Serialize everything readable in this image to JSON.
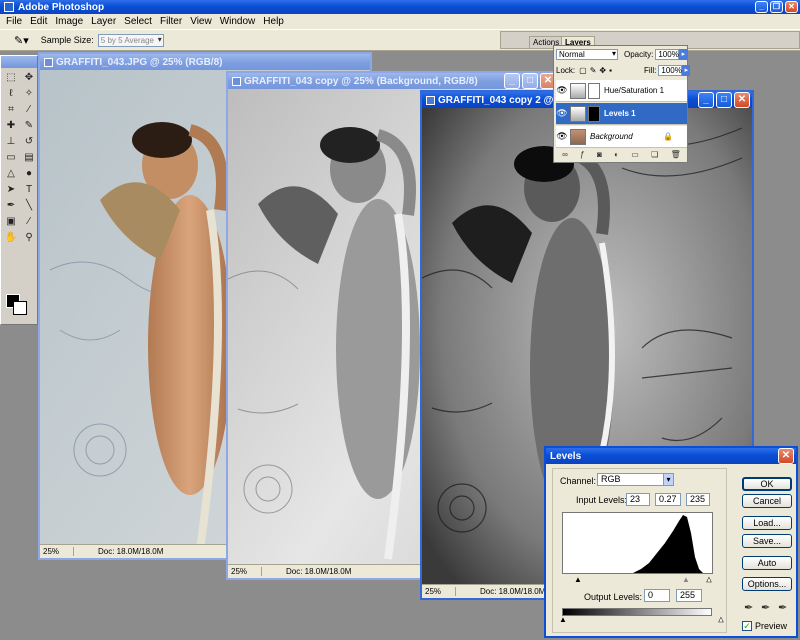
{
  "app": {
    "title": "Adobe Photoshop"
  },
  "menu": [
    "File",
    "Edit",
    "Image",
    "Layer",
    "Select",
    "Filter",
    "View",
    "Window",
    "Help"
  ],
  "options": {
    "sample_size_label": "Sample Size:",
    "sample_size_value": "5 by 5 Average"
  },
  "docs": [
    {
      "title": "GRAFFITI_043.JPG @ 25% (RGB/8)",
      "zoom": "25%",
      "doc_info": "Doc: 18.0M/18.0M"
    },
    {
      "title": "GRAFFITI_043 copy @ 25% (Background, RGB/8)",
      "zoom": "25%",
      "doc_info": "Doc: 18.0M/18.0M"
    },
    {
      "title": "GRAFFITI_043 copy 2 @ 25% (",
      "zoom": "25%",
      "doc_info": "Doc: 18.0M/18.0M"
    }
  ],
  "layers_panel": {
    "tabs": [
      "Actions",
      "Layers"
    ],
    "blend_mode": "Normal",
    "opacity_label": "Opacity:",
    "opacity": "100%",
    "lock_label": "Lock:",
    "fill_label": "Fill:",
    "fill": "100%",
    "layers": [
      {
        "name": "Hue/Saturation 1"
      },
      {
        "name": "Levels 1"
      },
      {
        "name": "Background"
      }
    ]
  },
  "levels": {
    "title": "Levels",
    "channel_label": "Channel:",
    "channel": "RGB",
    "input_label": "Input Levels:",
    "input_black": "23",
    "input_gamma": "0.27",
    "input_white": "235",
    "output_label": "Output Levels:",
    "output_black": "0",
    "output_white": "255",
    "buttons": {
      "ok": "OK",
      "cancel": "Cancel",
      "load": "Load...",
      "save": "Save...",
      "auto": "Auto",
      "options": "Options..."
    },
    "preview_label": "Preview",
    "preview_checked": true
  },
  "colors": {
    "xp_blue": "#0a4fd6",
    "selected_layer": "#316ac5"
  }
}
